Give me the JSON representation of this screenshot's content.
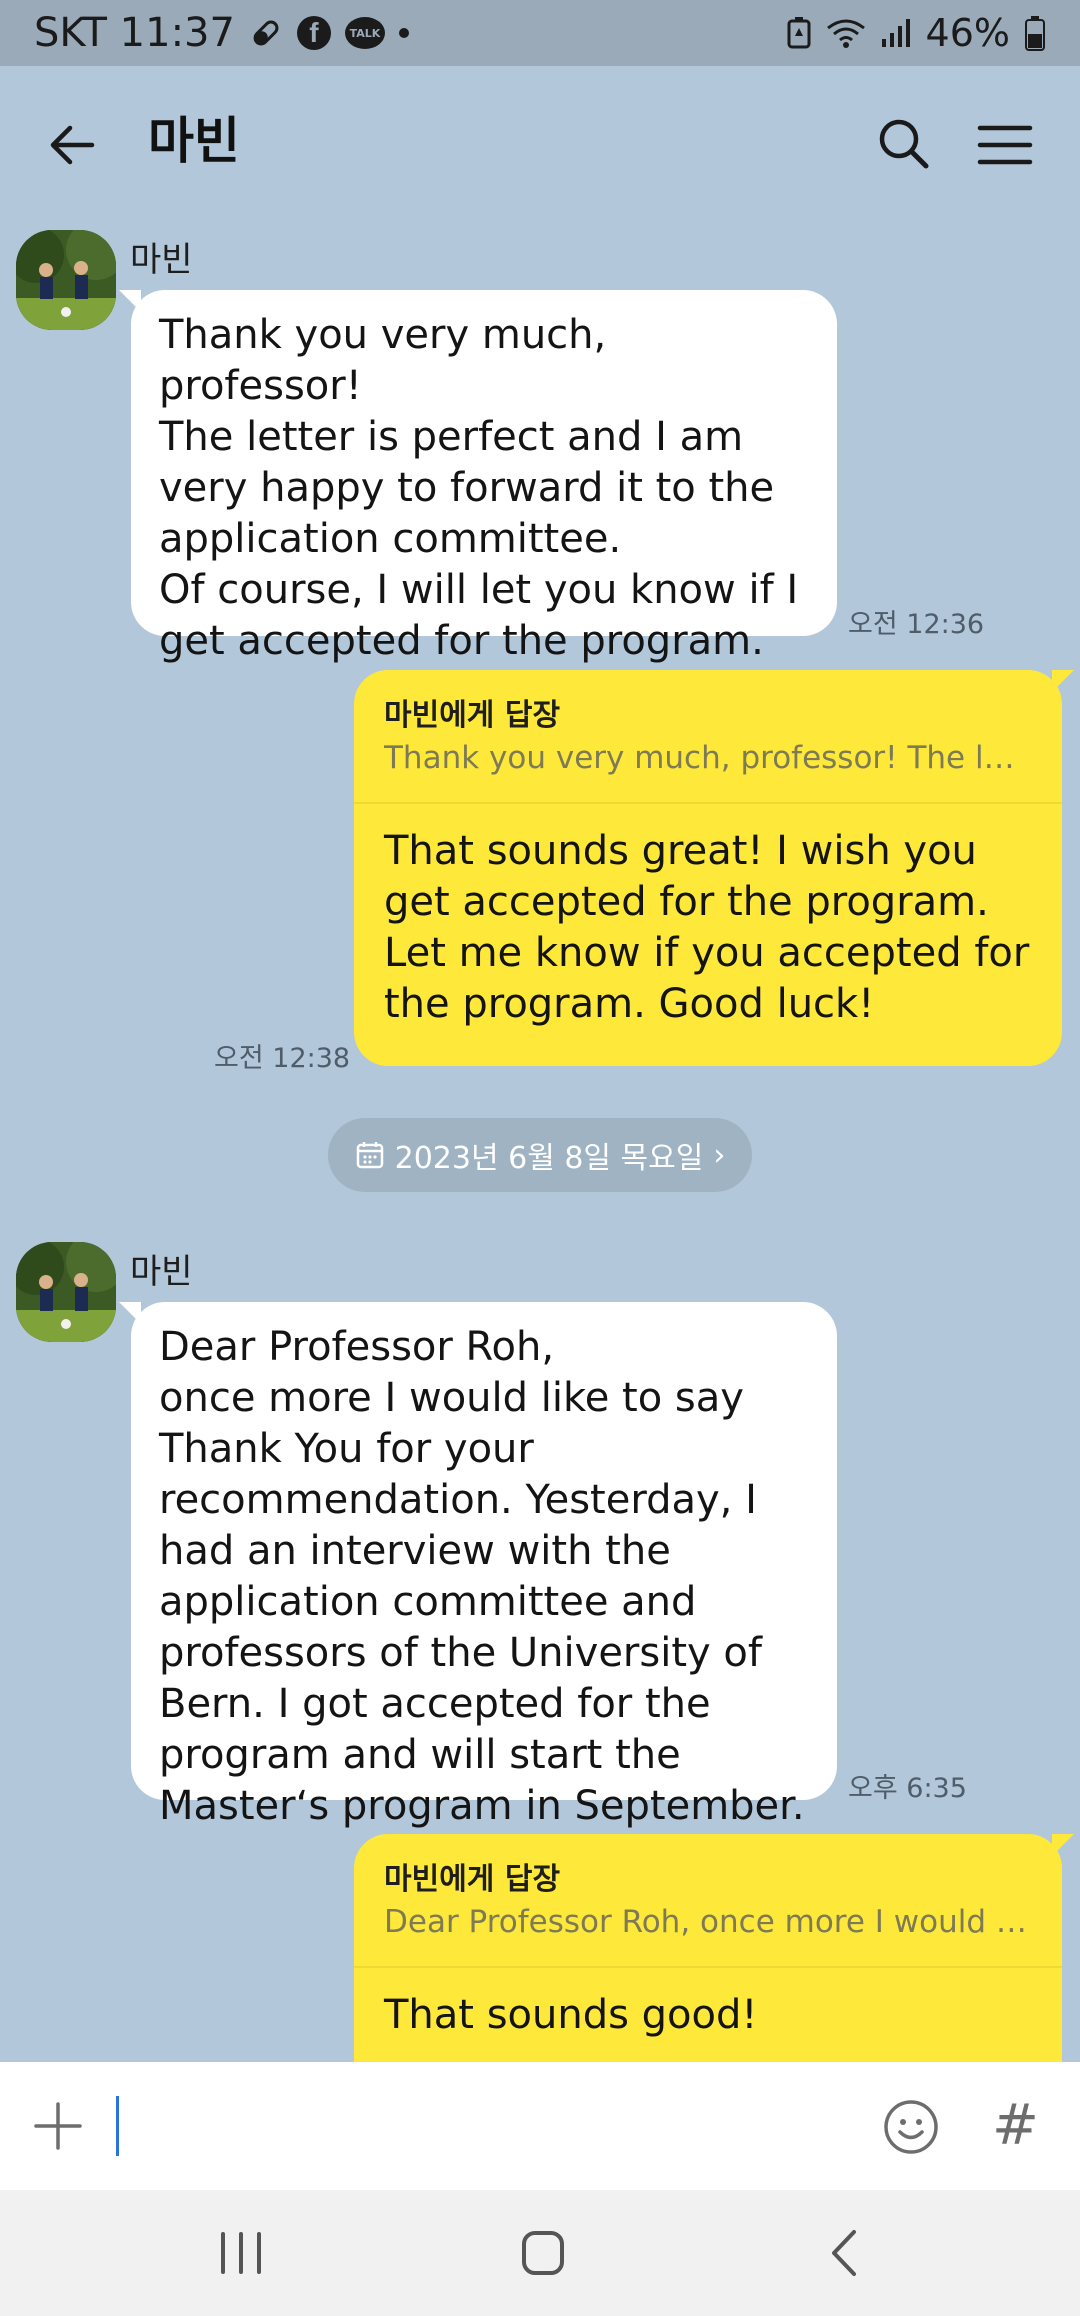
{
  "status_bar": {
    "carrier_time": "SKT 11:37",
    "fb_glyph": "f",
    "talk_glyph": "TALK",
    "battery": "46%"
  },
  "header": {
    "title": "마빈"
  },
  "messages": [
    {
      "sender": "마빈",
      "text": "Thank you very much, professor!\nThe letter is perfect and I am very happy to forward it to the application committee.\nOf course, I will let you know if I get accepted for the program.",
      "time": "오전 12:36"
    },
    {
      "reply_to": "마빈에게 답장",
      "quote": "Thank you very much, professor! The lett...",
      "text": "That sounds great! I wish you get accepted for the program. Let me know if you accepted for the program. Good luck!",
      "time": "오전 12:38"
    },
    {
      "sender": "마빈",
      "text": "Dear Professor Roh,\nonce more I would like to say Thank You for your recommendation. Yesterday, I had an interview with the application committee and professors of the University of Bern. I got accepted for the program and will start the Master‘s program in September.",
      "time": "오후 6:35"
    },
    {
      "reply_to": "마빈에게 답장",
      "quote": "Dear Professor Roh, once more I would li...",
      "text": "That sounds good!"
    }
  ],
  "date_divider": "2023년 6월 8일 목요일",
  "date_chevron": "›",
  "input": {
    "hash_label": "#"
  },
  "icons": {
    "back": "arrow-left-icon",
    "search": "search-icon",
    "menu": "hamburger-menu-icon",
    "plus": "plus-icon",
    "emoji": "emoji-icon",
    "calendar": "calendar-icon"
  },
  "colors": {
    "chat_background": "#b2c7d9",
    "outgoing_bubble": "#fee93a",
    "incoming_bubble": "#ffffff",
    "status_bar": "#9aaab8"
  }
}
